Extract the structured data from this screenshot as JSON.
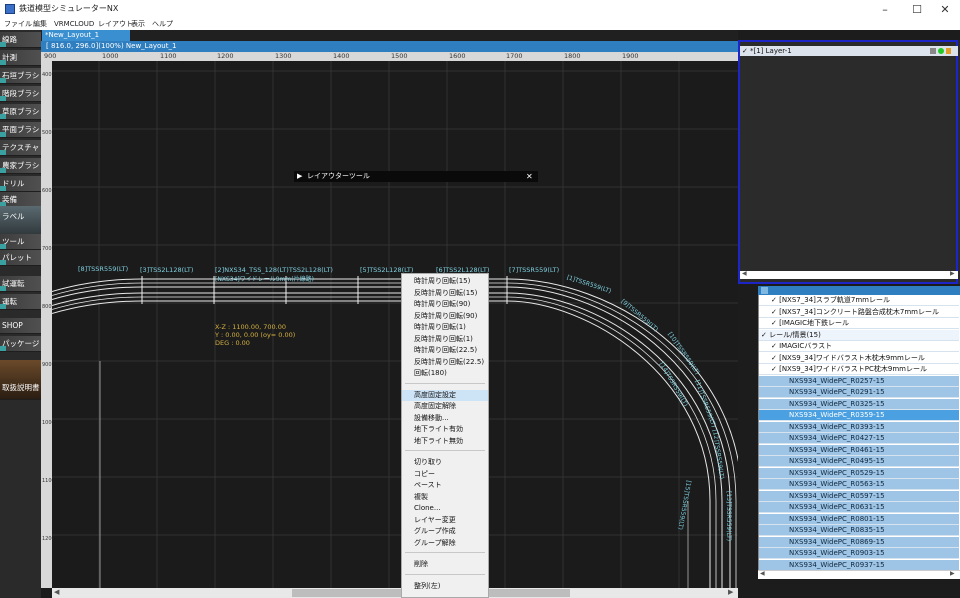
{
  "window": {
    "title": "鉄道模型シミュレーターNX"
  },
  "menubar": [
    "ファイル",
    "編集",
    "VRMCLOUD",
    "レイアウト",
    "表示",
    "ヘルプ"
  ],
  "tool_palette": [
    "線路",
    "計測",
    "石垣ブラシ",
    "階段ブラシ",
    "草原ブラシ",
    "平面ブラシ",
    "テクスチャ",
    "農家ブラシ",
    "ドリル",
    "装備",
    "ラベル",
    "ツール",
    "パレット",
    "試運転",
    "運転",
    "SHOP",
    "パッケージ",
    "取扱説明書"
  ],
  "document": {
    "tab": "*New_Layout_1",
    "status": "[  816.0,   296.0](100%) New_Layout_1"
  },
  "ruler": {
    "top": [
      "900",
      "1000",
      "1100",
      "1200",
      "1300",
      "1400",
      "1500",
      "1600",
      "1700",
      "1800",
      "1900"
    ],
    "left": [
      "400",
      "500",
      "600",
      "700",
      "800",
      "900",
      "1000",
      "1100",
      "1200"
    ]
  },
  "layout_tool": {
    "title": "レイアウターツール"
  },
  "canvas": {
    "track_labels": [
      "[8]TSSR559(LT)",
      "[3]TSS2L128(LT)",
      "[2]NXS34_TSS_128(LT)TSS2L128(LT)",
      "[5]TSS2L128(LT)",
      "[6]TSS2L128(LT)",
      "[7]TSSR559(LT)",
      "[NXS34]ワイドレール9mm(片線路)"
    ],
    "curve_labels": [
      "[1]TSSR559(LT)",
      "[9]TSSR559(LT)",
      "[10]TSSR559(LT)",
      "[11]TSSR559(LT)",
      "[12]TSSR559(LT)",
      "[13]TSSR559(LT)",
      "[14]TSSR559(LT)",
      "[15]TSSR559(LT)"
    ],
    "coords": [
      "X-Z : 1100.00,   700.00",
      "Y :   0.00,   0.00 (oy=   0.00)",
      "DEG : 0.00"
    ]
  },
  "layer_panel": {
    "row": "*[1] Layer-1"
  },
  "parts_panel": {
    "rows": [
      {
        "text": "[NXS7_34]スラブ軌道7mmレール",
        "level": 1,
        "type": "item"
      },
      {
        "text": "[NXS7_34]コンクリート路盤合成枕木7mmレール",
        "level": 1,
        "type": "item"
      },
      {
        "text": "[IMAGIC地下鉄レール",
        "level": 1,
        "type": "item"
      },
      {
        "text": "レール/情景(15)",
        "level": 0,
        "type": "group"
      },
      {
        "text": "IMAGICバラスト",
        "level": 1,
        "type": "item"
      },
      {
        "text": "[NXS9_34]ワイドバラスト木枕木9mmレール",
        "level": 1,
        "type": "item"
      },
      {
        "text": "[NXS9_34]ワイドバラストPC枕木9mmレール",
        "level": 1,
        "type": "item"
      },
      {
        "text": "NXS934_WidePC_R0257-15",
        "level": 2,
        "type": "sub"
      },
      {
        "text": "NXS934_WidePC_R0291-15",
        "level": 2,
        "type": "sub"
      },
      {
        "text": "NXS934_WidePC_R0325-15",
        "level": 2,
        "type": "sub"
      },
      {
        "text": "NXS934_WidePC_R0359-15",
        "level": 2,
        "type": "sel"
      },
      {
        "text": "NXS934_WidePC_R0393-15",
        "level": 2,
        "type": "sub"
      },
      {
        "text": "NXS934_WidePC_R0427-15",
        "level": 2,
        "type": "sub"
      },
      {
        "text": "NXS934_WidePC_R0461-15",
        "level": 2,
        "type": "sub"
      },
      {
        "text": "NXS934_WidePC_R0495-15",
        "level": 2,
        "type": "sub"
      },
      {
        "text": "NXS934_WidePC_R0529-15",
        "level": 2,
        "type": "sub"
      },
      {
        "text": "NXS934_WidePC_R0563-15",
        "level": 2,
        "type": "sub"
      },
      {
        "text": "NXS934_WidePC_R0597-15",
        "level": 2,
        "type": "sub"
      },
      {
        "text": "NXS934_WidePC_R0631-15",
        "level": 2,
        "type": "sub"
      },
      {
        "text": "NXS934_WidePC_R0801-15",
        "level": 2,
        "type": "sub"
      },
      {
        "text": "NXS934_WidePC_R0835-15",
        "level": 2,
        "type": "sub"
      },
      {
        "text": "NXS934_WidePC_R0869-15",
        "level": 2,
        "type": "sub"
      },
      {
        "text": "NXS934_WidePC_R0903-15",
        "level": 2,
        "type": "sub"
      },
      {
        "text": "NXS934_WidePC_R0937-15",
        "level": 2,
        "type": "sub"
      }
    ]
  },
  "context_menu": {
    "items": [
      {
        "label": "時計周り回転(15)"
      },
      {
        "label": "反時計周り回転(15)"
      },
      {
        "label": "時計周り回転(90)"
      },
      {
        "label": "反時計周り回転(90)"
      },
      {
        "label": "時計周り回転(1)"
      },
      {
        "label": "反時計周り回転(1)"
      },
      {
        "label": "時計周り回転(22.5)"
      },
      {
        "label": "反時計周り回転(22.5)"
      },
      {
        "label": "回転(180)",
        "sep_after": true
      },
      {
        "label": "高度固定設定",
        "highlight": true
      },
      {
        "label": "高度固定解除"
      },
      {
        "label": "設備移動..."
      },
      {
        "label": "地下ライト有効"
      },
      {
        "label": "地下ライト無効",
        "sep_after": true
      },
      {
        "label": "切り取り"
      },
      {
        "label": "コピー"
      },
      {
        "label": "ペースト"
      },
      {
        "label": "複製"
      },
      {
        "label": "Clone..."
      },
      {
        "label": "レイヤー変更"
      },
      {
        "label": "グループ作成"
      },
      {
        "label": "グループ解除",
        "sep_after": true
      },
      {
        "label": "削除",
        "sep_after": true
      },
      {
        "label": "整列(左)"
      }
    ]
  },
  "colors": {
    "accent": "#2f7fc0",
    "selection": "#8fbfe6",
    "canvas": "#1b1b1b",
    "track_label": "#7fd0e0",
    "coords": "#d4b040"
  },
  "icons": [
    "minimize-icon",
    "maximize-icon",
    "close-icon",
    "play-icon",
    "close-icon",
    "check-icon"
  ]
}
